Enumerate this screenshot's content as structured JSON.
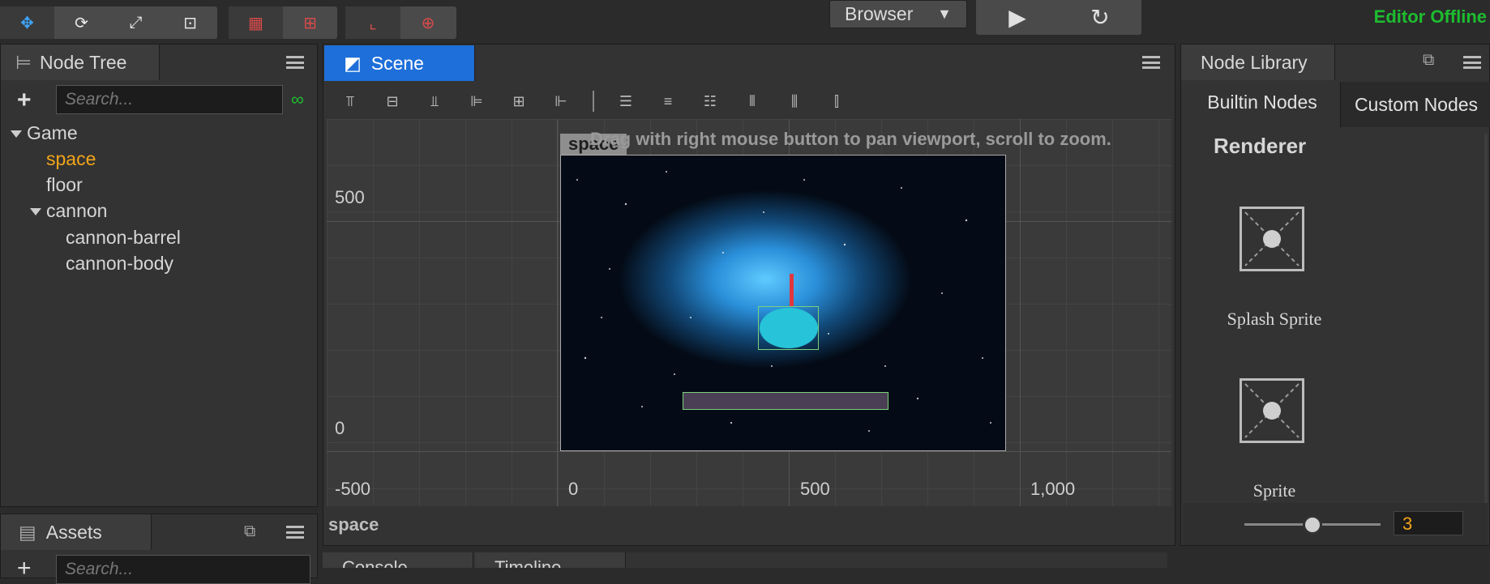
{
  "toolbar": {
    "transform_icons": [
      "move-icon",
      "rotate-icon",
      "scale-icon",
      "rect-icon"
    ],
    "pivot_icons": [
      "pivot-icon",
      "center-icon"
    ],
    "coord_icons": [
      "local-icon",
      "global-icon"
    ],
    "platform_label": "Browser",
    "play_icon": "play-icon",
    "refresh_icon": "refresh-icon",
    "status": "Editor Offline"
  },
  "node_tree": {
    "title": "Node Tree",
    "search_placeholder": "Search...",
    "items": [
      {
        "label": "Game",
        "depth": 0,
        "expanded": true
      },
      {
        "label": "space",
        "depth": 1,
        "selected": true
      },
      {
        "label": "floor",
        "depth": 1
      },
      {
        "label": "cannon",
        "depth": 1,
        "expanded": true
      },
      {
        "label": "cannon-barrel",
        "depth": 2
      },
      {
        "label": "cannon-body",
        "depth": 2
      }
    ]
  },
  "assets": {
    "title": "Assets",
    "search_placeholder": "Search..."
  },
  "scene": {
    "tab_label": "Scene",
    "hint": "Drag with right mouse button to pan viewport, scroll to zoom.",
    "canvas_label": "space",
    "footer_label": "space",
    "x_ticks": [
      "-500",
      "0",
      "500",
      "1,000"
    ],
    "y_ticks": [
      "500",
      "0"
    ]
  },
  "bottom_tabs": [
    "Console",
    "Timeline"
  ],
  "node_library": {
    "title": "Node Library",
    "tabs": [
      "Builtin Nodes",
      "Custom Nodes"
    ],
    "section": "Renderer",
    "items": [
      "Splash Sprite",
      "Sprite"
    ],
    "zoom_value": "3"
  },
  "colors": {
    "accent": "#1e6fd9",
    "selected": "#f2a51a",
    "online_status": "#1dbd2f",
    "barrel": "#e0383e",
    "cannon_body": "#27c3d8",
    "floor": "#4b3f55"
  }
}
